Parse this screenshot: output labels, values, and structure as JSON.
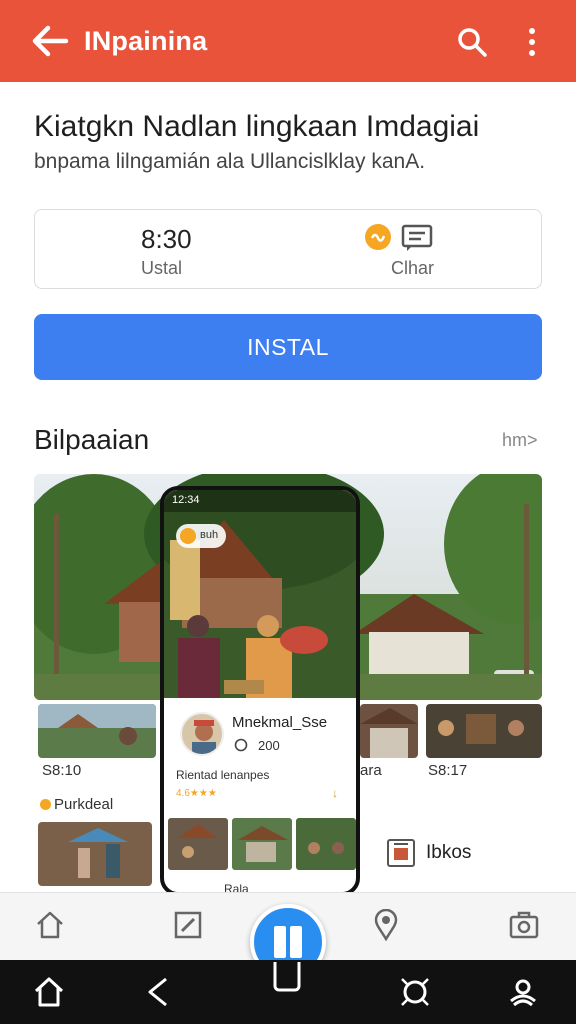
{
  "appbar": {
    "title": "INpainina",
    "icons": [
      "back-arrow-icon",
      "search-icon",
      "more-vert-icon"
    ],
    "color": "#e8533a"
  },
  "header": {
    "title": "Kiatgkn Nadlan lingkaan Imdagiai",
    "subtitle": "bnpama lilngamián ala Ullancislklay kanA."
  },
  "info_card": {
    "time": "8:30",
    "time_label": "Ustal",
    "chat_label": "Clhar",
    "icons": [
      "orange-badge-icon",
      "chat-icon"
    ]
  },
  "install_button": {
    "label": "INSTAL",
    "color": "#3d7ef0"
  },
  "gallery": {
    "title": "Bilpaaian",
    "more": "hm>",
    "thumb_captions": [
      "S8:10",
      "ara",
      "S8:17"
    ],
    "purchase_label": "Purkdeal",
    "book_label": "Ibkos"
  },
  "phone_preview": {
    "status_time": "12:34",
    "pill_text": "ʙuh",
    "name": "Mnekmal_Sse",
    "count": "200",
    "subtitle": "Rientad lenanpes",
    "stars": "4.6★★★",
    "footer_text": "Rala"
  },
  "bottom_nav": {
    "icons": [
      "home-icon",
      "edit-icon",
      "fab-action-icon",
      "location-pin-icon",
      "camera-icon"
    ],
    "fab_color": "#2a8ef0"
  },
  "system_nav": {
    "icons": [
      "home-icon",
      "back-icon",
      "recent-apps-icon",
      "assistant-icon",
      "accessibility-icon"
    ]
  }
}
